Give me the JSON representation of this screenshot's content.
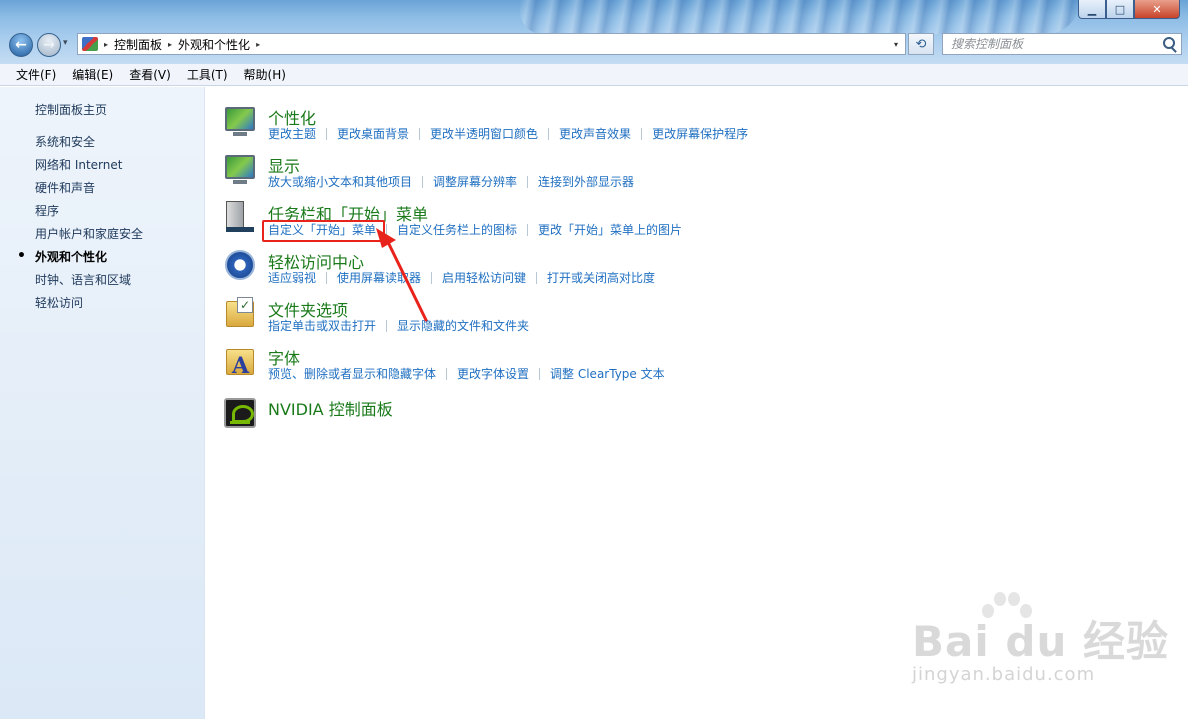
{
  "window": {
    "minimize_symbol": "▁",
    "maximize_symbol": "□",
    "close_symbol": "✕"
  },
  "address": {
    "crumbs": [
      "控制面板",
      "外观和个性化"
    ],
    "separator": "▸",
    "dropdown": "▾"
  },
  "search": {
    "placeholder": "搜索控制面板"
  },
  "menubar": {
    "items": [
      "文件(F)",
      "编辑(E)",
      "查看(V)",
      "工具(T)",
      "帮助(H)"
    ]
  },
  "sidebar": {
    "home": "控制面板主页",
    "items": [
      {
        "label": "系统和安全",
        "current": false
      },
      {
        "label": "网络和 Internet",
        "current": false
      },
      {
        "label": "硬件和声音",
        "current": false
      },
      {
        "label": "程序",
        "current": false
      },
      {
        "label": "用户帐户和家庭安全",
        "current": false
      },
      {
        "label": "外观和个性化",
        "current": true
      },
      {
        "label": "时钟、语言和区域",
        "current": false
      },
      {
        "label": "轻松访问",
        "current": false
      }
    ]
  },
  "categories": [
    {
      "title": "个性化",
      "icon": "personalization-icon",
      "links": [
        "更改主题",
        "更改桌面背景",
        "更改半透明窗口颜色",
        "更改声音效果",
        "更改屏幕保护程序"
      ]
    },
    {
      "title": "显示",
      "icon": "display-icon",
      "links": [
        "放大或缩小文本和其他项目",
        "调整屏幕分辨率",
        "连接到外部显示器"
      ]
    },
    {
      "title": "任务栏和「开始」菜单",
      "icon": "taskbar-icon",
      "links": [
        "自定义「开始」菜单",
        "自定义任务栏上的图标",
        "更改「开始」菜单上的图片"
      ]
    },
    {
      "title": "轻松访问中心",
      "icon": "ease-of-access-icon",
      "links": [
        "适应弱视",
        "使用屏幕读取器",
        "启用轻松访问键",
        "打开或关闭高对比度"
      ]
    },
    {
      "title": "文件夹选项",
      "icon": "folder-options-icon",
      "links": [
        "指定单击或双击打开",
        "显示隐藏的文件和文件夹"
      ]
    },
    {
      "title": "字体",
      "icon": "fonts-icon",
      "links": [
        "预览、删除或者显示和隐藏字体",
        "更改字体设置",
        "调整 ClearType 文本"
      ]
    },
    {
      "title": "NVIDIA 控制面板",
      "icon": "nvidia-icon",
      "links": []
    }
  ],
  "annotation": {
    "color": "#e8231b"
  },
  "watermark": {
    "logo": "Bai du 经验",
    "sub": "jingyan.baidu.com"
  },
  "colors": {
    "category_title": "#1a7a1a",
    "link": "#1f6fc1"
  }
}
